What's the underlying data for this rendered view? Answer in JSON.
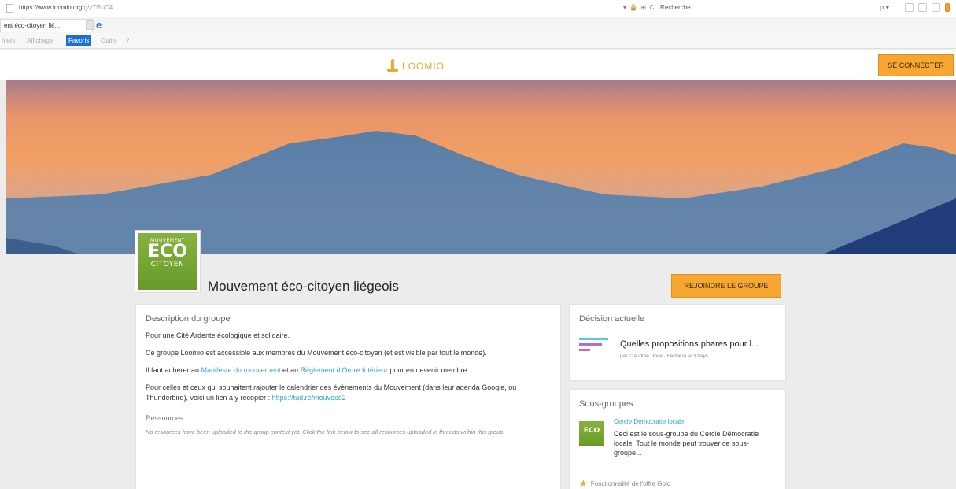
{
  "browser": {
    "url_host": "https://www.loomio.org",
    "url_path": "/g/yTl5pC4",
    "search_placeholder": "Recherche...",
    "addr_tools": "▾ 🔒 ⊞ C",
    "tab_label": "ent éco-citoyen lié...",
    "tab_close": "×",
    "menu": [
      "hiers",
      "Affichage",
      "Favoris",
      "Outils",
      "?"
    ],
    "search_mag": "ρ ▾"
  },
  "header": {
    "logo_text": "LOOMIO",
    "connect_label": "SE CONNECTER",
    "brand_color": "#f6a631"
  },
  "group": {
    "avatar_line1": "MOUVEMENT",
    "avatar_line2": "ECO",
    "avatar_line3": "CITOYEN",
    "title": "Mouvement éco-citoyen liégeois",
    "join_label": "REJOINDRE LE GROUPE"
  },
  "description": {
    "title": "Description du groupe",
    "p1": "Pour une Cité Ardente écologique et solidaire.",
    "p2": "Ce groupe Loomio est accessible aux membres du Mouvement éco-citoyen (et est visible par tout le monde).",
    "p3_pre": "Il faut adhérer au ",
    "p3_link1": "Manifeste du mouvement",
    "p3_mid": " et au ",
    "p3_link2": "Règlement d'Ordre Intérieur",
    "p3_post": " pour en devenir membre.",
    "p4_pre": "Pour celles et ceux qui souhaitent rajouter le calendrier des évènements du Mouvement (dans leur agenda Google, ou Thunderbird), voici un lien à y recopier : ",
    "p4_link": "https://tud.re/mouveco2",
    "resources_title": "Ressources",
    "resources_text": "No resources have been uploaded to the group context yet. Click the link below to see all resources uploaded in threads within this group."
  },
  "decision": {
    "title": "Décision actuelle",
    "name": "Quelles propositions phares pour l...",
    "meta": "par Claudine Dove · Fermera le 3 days",
    "bar_colors": [
      "#5bc3ec",
      "#b06fc8",
      "#e0608a"
    ],
    "bar_levels": [
      0.92,
      0.72,
      0.35
    ]
  },
  "subgroups": {
    "title": "Sous-groupes",
    "item_avatar": "ECO",
    "item_name": "Cercle Démocratie locale",
    "item_desc": "Ceci est le sous-groupe du Cercle Démocratie locale. Tout le monde peut trouver ce sous-groupe...",
    "footer": "Fonctionnalité de l'offre Gold"
  }
}
